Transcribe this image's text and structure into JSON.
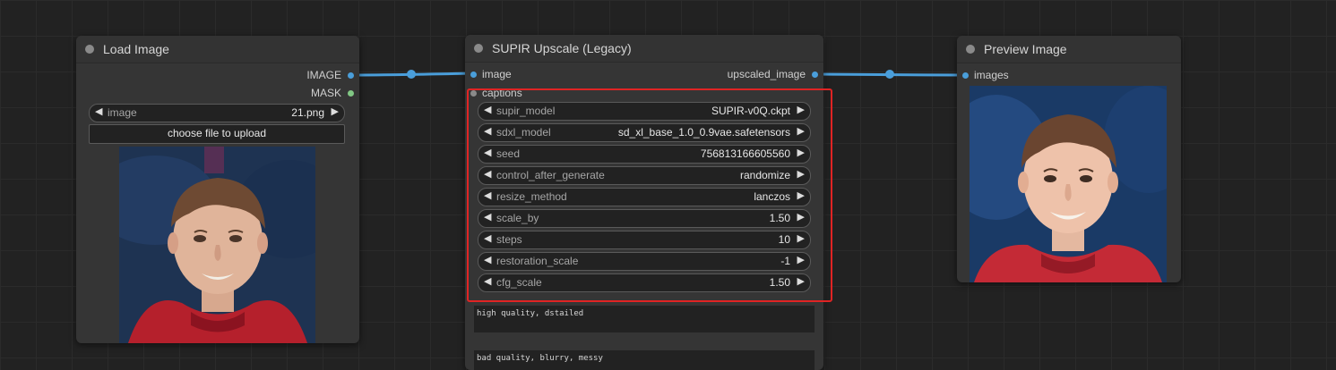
{
  "colors": {
    "image_slot": "#4a9eda",
    "mask_slot": "#81c784",
    "wire": "#4a9eda",
    "highlight": "#e02424"
  },
  "load_image": {
    "title": "Load Image",
    "outputs": [
      "IMAGE",
      "MASK"
    ],
    "image_widget": {
      "label": "image",
      "value": "21.png"
    },
    "upload_label": "choose file to upload"
  },
  "supir": {
    "title": "SUPIR Upscale (Legacy)",
    "inputs": [
      "image",
      "captions"
    ],
    "output": "upscaled_image",
    "widgets": [
      {
        "label": "supir_model",
        "value": "SUPIR-v0Q.ckpt"
      },
      {
        "label": "sdxl_model",
        "value": "sd_xl_base_1.0_0.9vae.safetensors"
      },
      {
        "label": "seed",
        "value": "756813166605560"
      },
      {
        "label": "control_after_generate",
        "value": "randomize"
      },
      {
        "label": "resize_method",
        "value": "lanczos"
      },
      {
        "label": "scale_by",
        "value": "1.50"
      },
      {
        "label": "steps",
        "value": "10"
      },
      {
        "label": "restoration_scale",
        "value": "-1"
      },
      {
        "label": "cfg_scale",
        "value": "1.50"
      }
    ],
    "positive_prompt": "high quality, dstailed",
    "negative_prompt": "bad quality, blurry, messy"
  },
  "preview": {
    "title": "Preview Image",
    "input": "images"
  }
}
